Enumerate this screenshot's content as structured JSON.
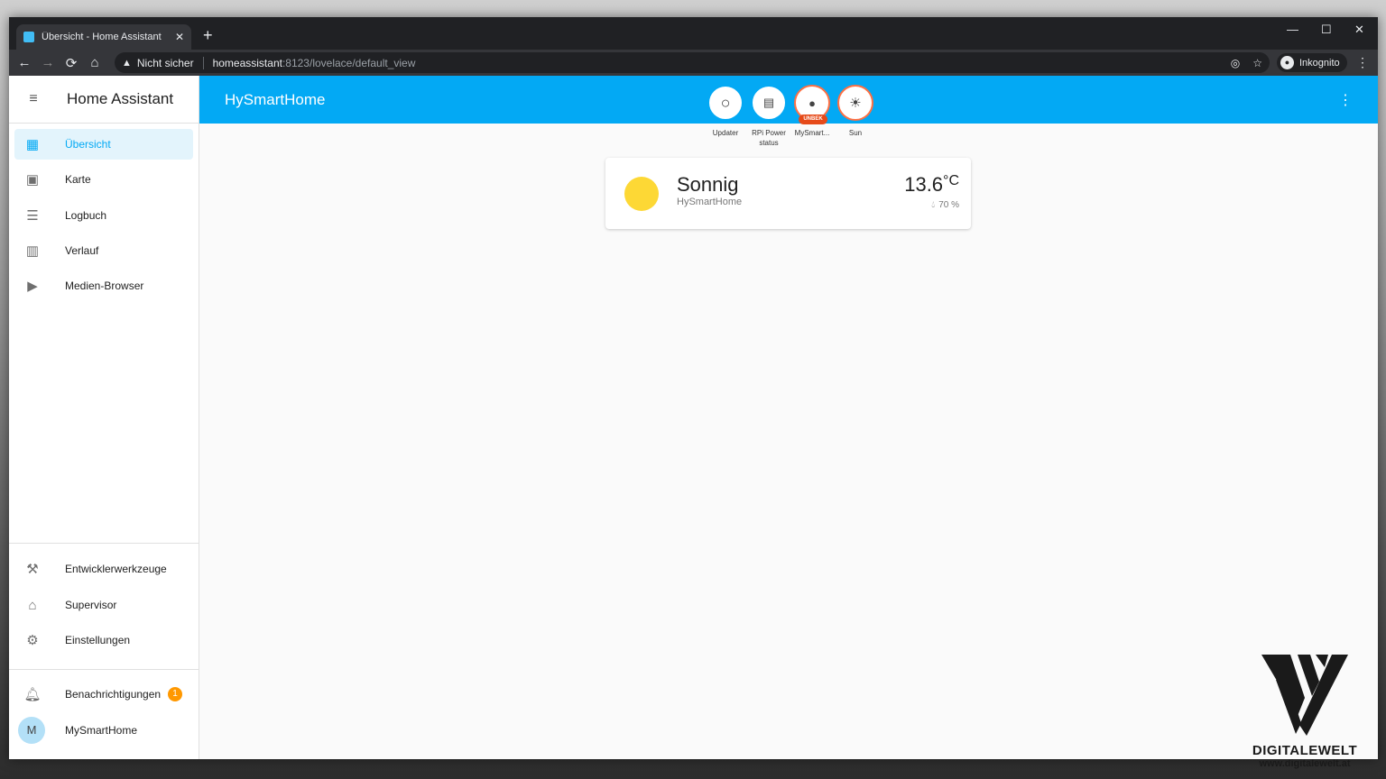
{
  "browser": {
    "tab_title": "Übersicht - Home Assistant",
    "tab_close": "✕",
    "new_tab": "+",
    "minimize": "—",
    "maximize": "☐",
    "close": "✕",
    "security_warning": "Nicht sicher",
    "url_host": "homeassistant",
    "url_rest": ":8123/lovelace/default_view",
    "incognito_label": "Inkognito"
  },
  "sidebar": {
    "title": "Home Assistant",
    "items": [
      {
        "label": "Übersicht",
        "icon": "dashboard-icon",
        "active": true
      },
      {
        "label": "Karte",
        "icon": "map-account-icon"
      },
      {
        "label": "Logbuch",
        "icon": "list-icon"
      },
      {
        "label": "Verlauf",
        "icon": "chart-bar-icon"
      },
      {
        "label": "Medien-Browser",
        "icon": "media-play-icon"
      }
    ],
    "bottom_items": [
      {
        "label": "Entwicklerwerkzeuge",
        "icon": "hammer-icon"
      },
      {
        "label": "Supervisor",
        "icon": "supervisor-home-icon"
      },
      {
        "label": "Einstellungen",
        "icon": "gear-icon"
      }
    ],
    "notifications": {
      "label": "Benachrichtigungen",
      "count": "1"
    },
    "user": {
      "label": "MySmartHome",
      "initial": "M"
    }
  },
  "header": {
    "title": "HySmartHome"
  },
  "badges": [
    {
      "label": "Updater",
      "icon": "circle-outline-icon"
    },
    {
      "label": "RPi Power status",
      "icon": "raspberry-pi-icon"
    },
    {
      "label": "MySmart...",
      "icon": "person-icon",
      "tag": "UNBEK"
    },
    {
      "label": "Sun",
      "icon": "sun-icon"
    }
  ],
  "weather": {
    "state": "Sonnig",
    "name": "HySmartHome",
    "temperature": "13.6",
    "unit": "°C",
    "humidity": "70 %"
  },
  "watermark": {
    "name": "DIGITALEWELT",
    "url": "www.digitalewelt.at"
  },
  "colors": {
    "accent": "#03a9f4",
    "badge_orange": "#ff9800",
    "sun_yellow": "#fdd835"
  }
}
